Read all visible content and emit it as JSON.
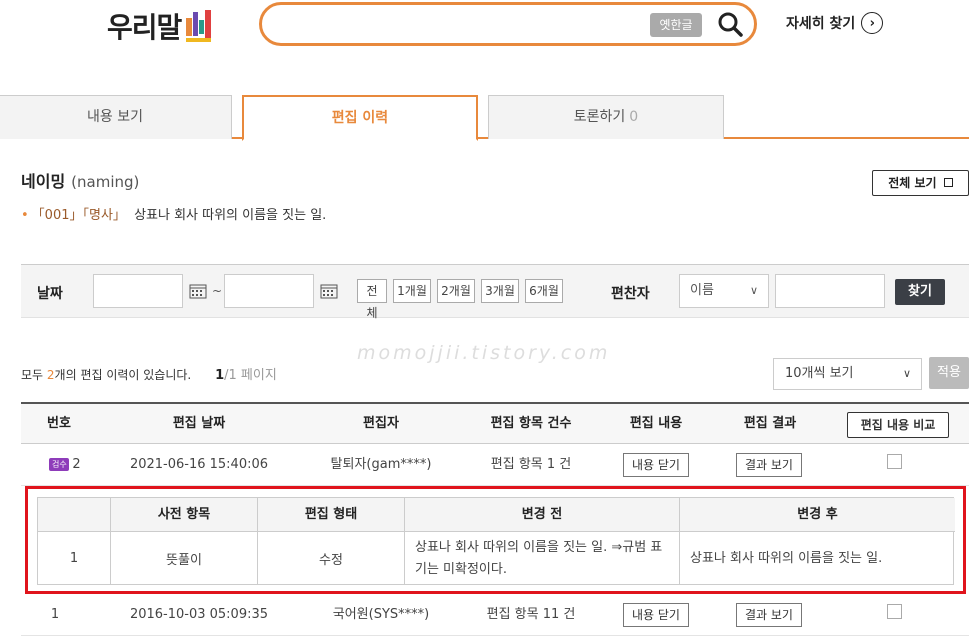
{
  "header": {
    "logo_text": "우리말",
    "search_placeholder": "",
    "old_hangul_label": "옛한글",
    "detail_search_label": "자세히 찾기"
  },
  "tabs": [
    {
      "label": "내용 보기",
      "active": false
    },
    {
      "label": "편집 이력",
      "active": true
    },
    {
      "label": "토론하기",
      "count": "0",
      "active": false
    }
  ],
  "entry": {
    "word": "네이밍",
    "romaji": "(naming)",
    "view_all_label": "전체 보기",
    "def_num": "「001」",
    "def_pos": "「명사」",
    "def_text": "상표나 회사 따위의 이름을 짓는 일."
  },
  "filter": {
    "date_label": "날짜",
    "tilde": "~",
    "periods": [
      "전체",
      "1개월",
      "2개월",
      "3개월",
      "6개월"
    ],
    "editor_label": "편찬자",
    "editor_select": "이름",
    "find_label": "찾기"
  },
  "summary": {
    "prefix": "모두 ",
    "count": "2",
    "suffix": "개의 편집 이력이 있습니다.",
    "page_current": "1",
    "page_total": "/1 페이지",
    "watermark": "momojjii.tistory.com",
    "per_page": "10개씩 보기",
    "apply_label": "적용"
  },
  "table": {
    "headers": [
      "번호",
      "편집 날짜",
      "편집자",
      "편집 항목 건수",
      "편집 내용",
      "편집 결과"
    ],
    "compare_label": "편집 내용 비교",
    "rows": [
      {
        "badge": "검수",
        "num": "2",
        "date": "2021-06-16 15:40:06",
        "editor": "탈퇴자(gam****)",
        "items": "편집 항목 1 건",
        "content_btn": "내용 닫기",
        "result_btn": "결과 보기"
      },
      {
        "badge": "",
        "num": "1",
        "date": "2016-10-03 05:09:35",
        "editor": "국어원(SYS****)",
        "items": "편집 항목 11 건",
        "content_btn": "내용 닫기",
        "result_btn": "결과 보기"
      }
    ]
  },
  "detail": {
    "headers": [
      "",
      "사전 항목",
      "편집 형태",
      "변경 전",
      "변경 후"
    ],
    "row": {
      "num": "1",
      "field": "뜻풀이",
      "type": "수정",
      "before": "상표나 회사 따위의 이름을 짓는 일. ⇒규범 표기는 미확정이다.",
      "after": "상표나 회사 따위의 이름을 짓는 일."
    }
  },
  "colors": {
    "accent": "#e8893c",
    "highlight_border": "#e0141c",
    "badge": "#8e3cba"
  }
}
